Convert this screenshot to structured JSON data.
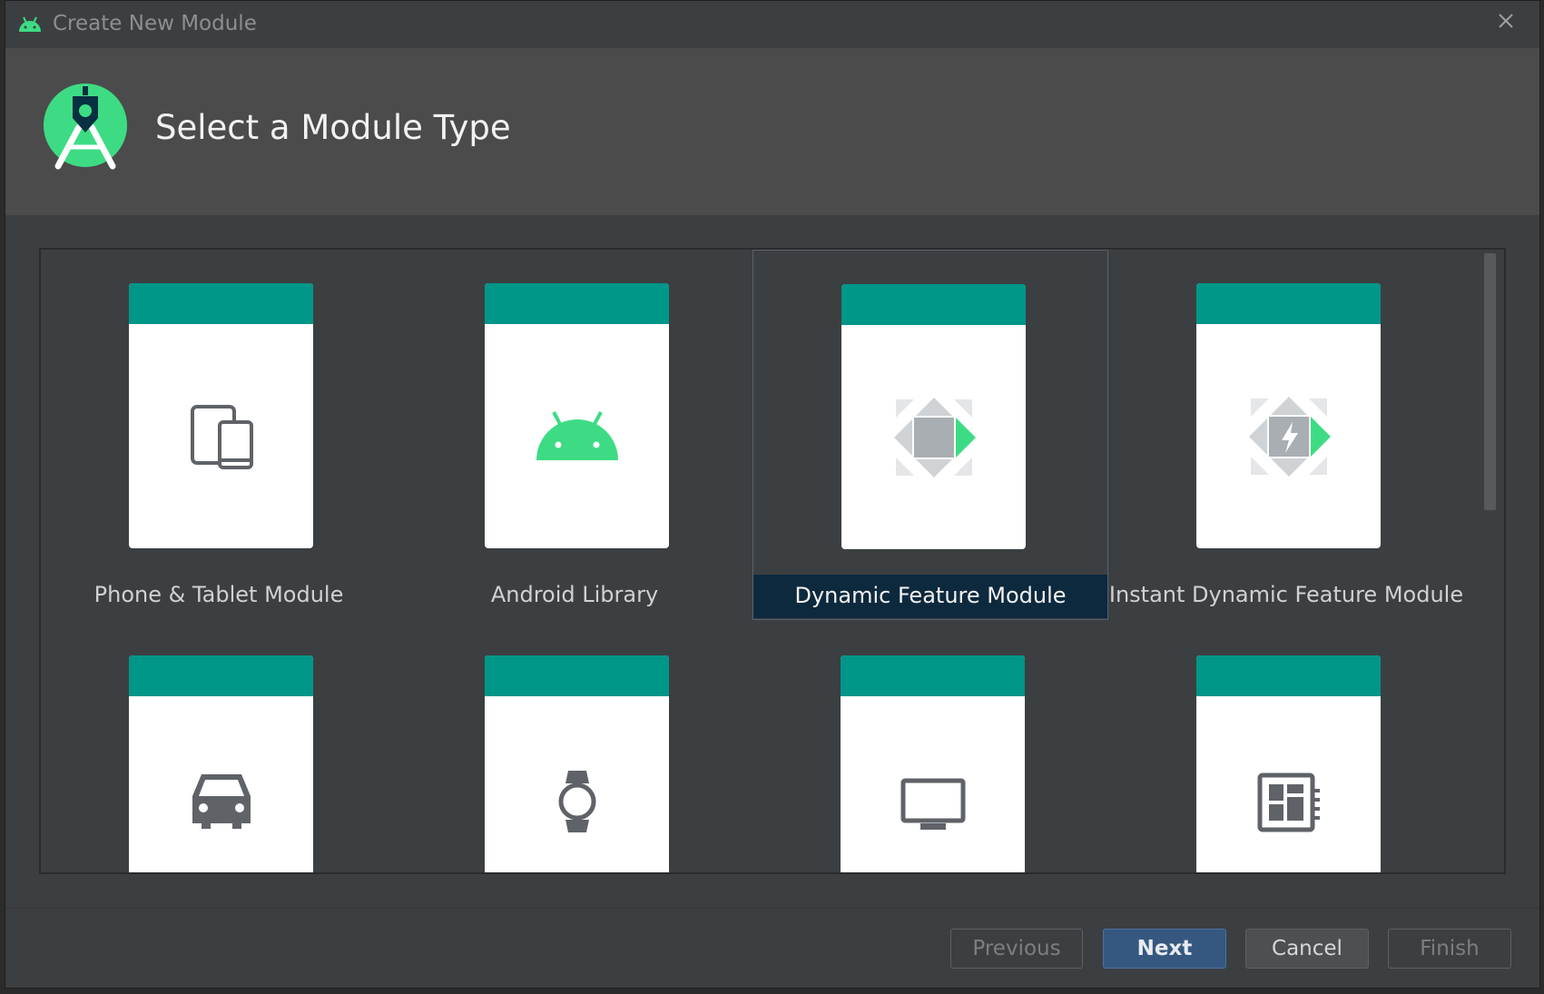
{
  "window": {
    "title": "Create New Module",
    "close_icon": "close-icon"
  },
  "header": {
    "title": "Select a Module Type",
    "logo": "android-studio-logo"
  },
  "modules": [
    {
      "label": "Phone & Tablet Module",
      "icon": "phone-tablet-icon",
      "selected": false
    },
    {
      "label": "Android Library",
      "icon": "android-head-icon",
      "selected": false
    },
    {
      "label": "Dynamic Feature Module",
      "icon": "dynamic-feature-icon",
      "selected": true
    },
    {
      "label": "Instant Dynamic Feature Module",
      "icon": "instant-dynamic-feature-icon",
      "selected": false
    },
    {
      "label": "",
      "icon": "car-icon",
      "selected": false
    },
    {
      "label": "",
      "icon": "watch-icon",
      "selected": false
    },
    {
      "label": "",
      "icon": "tv-icon",
      "selected": false
    },
    {
      "label": "",
      "icon": "things-board-icon",
      "selected": false
    }
  ],
  "buttons": {
    "previous": "Previous",
    "next": "Next",
    "cancel": "Cancel",
    "finish": "Finish"
  },
  "colors": {
    "accent": "#009688",
    "selection": "#0d293e",
    "primary_button": "#365880",
    "android_green": "#3ddc84"
  }
}
